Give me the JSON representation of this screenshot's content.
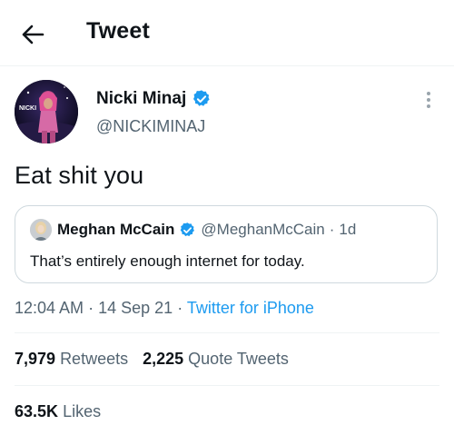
{
  "header": {
    "title": "Tweet",
    "back_icon": "arrow-left-icon"
  },
  "author": {
    "name": "Nicki Minaj",
    "handle": "@NICKIMINAJ",
    "verified": true,
    "avatar_caption": "NICKI"
  },
  "tweet": {
    "text": "Eat shit you"
  },
  "quote": {
    "name": "Meghan McCain",
    "handle": "@MeghanMcCain",
    "separator": "·",
    "time": "1d",
    "verified": true,
    "text": "That’s entirely enough internet for today."
  },
  "meta": {
    "time": "12:04 AM",
    "sep1": "·",
    "date": "14 Sep 21",
    "sep2": "·",
    "source": "Twitter for iPhone"
  },
  "stats": {
    "retweets_count": "7,979",
    "retweets_label": "Retweets",
    "quotes_count": "2,225",
    "quotes_label": "Quote Tweets",
    "likes_count": "63.5K",
    "likes_label": "Likes"
  },
  "colors": {
    "accent": "#1d9bf0",
    "secondary_text": "#536471",
    "border": "#cfd9de"
  }
}
